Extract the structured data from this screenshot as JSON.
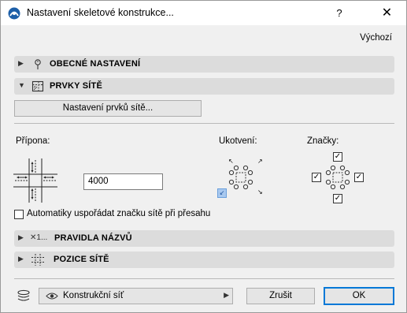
{
  "window": {
    "title": "Nastavení skeletové konstrukce..."
  },
  "titlebar": {
    "help": "?",
    "close": "✕"
  },
  "defaults_link": "Výchozí",
  "sections": {
    "general": {
      "label": "OBECNÉ NASTAVENÍ",
      "arrow": "▶"
    },
    "grid_elements": {
      "label": "PRVKY SÍTĚ",
      "arrow": "▼"
    },
    "naming_rules": {
      "label": "PRAVIDLA NÁZVŮ",
      "arrow": "▶",
      "icon_text": "✕1..."
    },
    "grid_position": {
      "label": "POZICE SÍTĚ",
      "arrow": "▶"
    }
  },
  "grid_elements_button": "Nastavení prvků sítě...",
  "suffix": {
    "label": "Přípona:",
    "value": "4000"
  },
  "anchor": {
    "label": "Ukotvení:"
  },
  "markers": {
    "label": "Značky:"
  },
  "auto_arrange": {
    "label": "Automatiky uspořádat značku sítě při přesahu",
    "checked": false
  },
  "footer": {
    "layer_value": "Konstrukční síť",
    "cancel": "Zrušit",
    "ok": "OK"
  },
  "colors": {
    "accent_blue": "#0078d7",
    "section_bg": "#dcdcdc"
  }
}
